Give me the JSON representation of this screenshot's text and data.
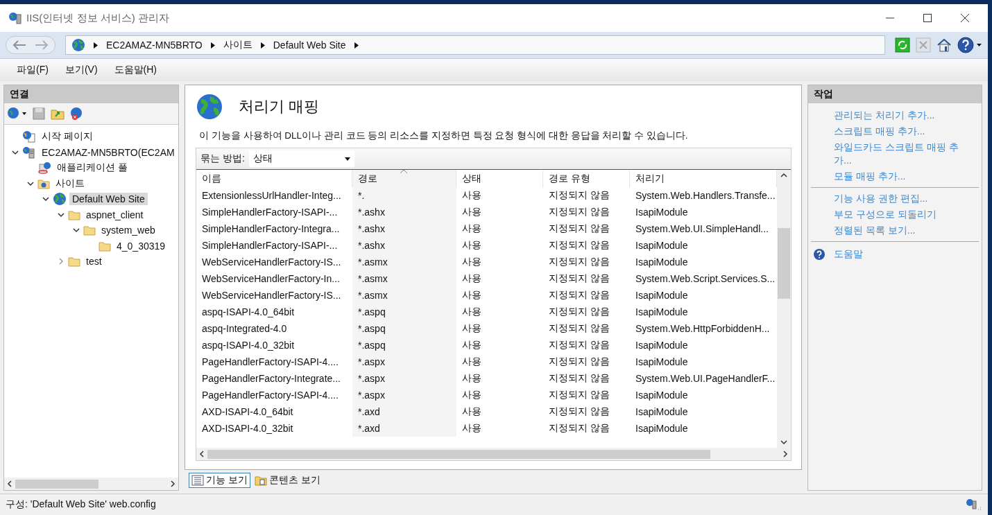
{
  "window": {
    "title": "IIS(인터넷 정보 서비스) 관리자"
  },
  "breadcrumb": [
    "EC2AMAZ-MN5BRTO",
    "사이트",
    "Default Web Site"
  ],
  "menu": [
    "파일(F)",
    "보기(V)",
    "도움말(H)"
  ],
  "connections": {
    "title": "연결",
    "tree": [
      {
        "label": "시작 페이지",
        "kind": "start",
        "selected": false
      },
      {
        "label": "EC2AMAZ-MN5BRTO(EC2AM",
        "kind": "server",
        "selected": false,
        "expanded": true,
        "children": [
          {
            "label": "애플리케이션 풀",
            "kind": "pool",
            "selected": false
          },
          {
            "label": "사이트",
            "kind": "sites",
            "selected": false,
            "expanded": true,
            "children": [
              {
                "label": "Default Web Site",
                "kind": "site",
                "selected": true,
                "expanded": true,
                "children": [
                  {
                    "label": "aspnet_client",
                    "kind": "folder",
                    "selected": false,
                    "expanded": true,
                    "children": [
                      {
                        "label": "system_web",
                        "kind": "folder",
                        "selected": false,
                        "expanded": true,
                        "children": [
                          {
                            "label": "4_0_30319",
                            "kind": "folder",
                            "selected": false
                          }
                        ]
                      }
                    ]
                  },
                  {
                    "label": "test",
                    "kind": "folder",
                    "selected": false,
                    "expanded": false
                  }
                ]
              }
            ]
          }
        ]
      }
    ]
  },
  "feature": {
    "title": "처리기 매핑",
    "description": "이 기능을 사용하여 DLL이나 관리 코드 등의 리소스를 지정하면 특정 요청 형식에 대한 응답을 처리할 수 있습니다.",
    "group_by": {
      "label": "묶는 방법:",
      "value": "상태"
    },
    "columns": [
      "이름",
      "경로",
      "상태",
      "경로 유형",
      "처리기"
    ],
    "rows": [
      [
        "ExtensionlessUrlHandler-Integ...",
        "*.",
        "사용",
        "지정되지 않음",
        "System.Web.Handlers.Transfe..."
      ],
      [
        "SimpleHandlerFactory-ISAPI-...",
        "*.ashx",
        "사용",
        "지정되지 않음",
        "IsapiModule"
      ],
      [
        "SimpleHandlerFactory-Integra...",
        "*.ashx",
        "사용",
        "지정되지 않음",
        "System.Web.UI.SimpleHandl..."
      ],
      [
        "SimpleHandlerFactory-ISAPI-...",
        "*.ashx",
        "사용",
        "지정되지 않음",
        "IsapiModule"
      ],
      [
        "WebServiceHandlerFactory-IS...",
        "*.asmx",
        "사용",
        "지정되지 않음",
        "IsapiModule"
      ],
      [
        "WebServiceHandlerFactory-In...",
        "*.asmx",
        "사용",
        "지정되지 않음",
        "System.Web.Script.Services.S..."
      ],
      [
        "WebServiceHandlerFactory-IS...",
        "*.asmx",
        "사용",
        "지정되지 않음",
        "IsapiModule"
      ],
      [
        "aspq-ISAPI-4.0_64bit",
        "*.aspq",
        "사용",
        "지정되지 않음",
        "IsapiModule"
      ],
      [
        "aspq-Integrated-4.0",
        "*.aspq",
        "사용",
        "지정되지 않음",
        "System.Web.HttpForbiddenH..."
      ],
      [
        "aspq-ISAPI-4.0_32bit",
        "*.aspq",
        "사용",
        "지정되지 않음",
        "IsapiModule"
      ],
      [
        "PageHandlerFactory-ISAPI-4....",
        "*.aspx",
        "사용",
        "지정되지 않음",
        "IsapiModule"
      ],
      [
        "PageHandlerFactory-Integrate...",
        "*.aspx",
        "사용",
        "지정되지 않음",
        "System.Web.UI.PageHandlerF..."
      ],
      [
        "PageHandlerFactory-ISAPI-4....",
        "*.aspx",
        "사용",
        "지정되지 않음",
        "IsapiModule"
      ],
      [
        "AXD-ISAPI-4.0_64bit",
        "*.axd",
        "사용",
        "지정되지 않음",
        "IsapiModule"
      ],
      [
        "AXD-ISAPI-4.0_32bit",
        "*.axd",
        "사용",
        "지정되지 않음",
        "IsapiModule"
      ]
    ],
    "views": [
      {
        "label": "기능 보기",
        "selected": true
      },
      {
        "label": "콘텐츠 보기",
        "selected": false
      }
    ]
  },
  "actions": {
    "title": "작업",
    "groups": [
      [
        {
          "kind": "link",
          "label": "관리되는 처리기 추가..."
        },
        {
          "kind": "link",
          "label": "스크립트 매핑 추가..."
        },
        {
          "kind": "link",
          "label": "와일드카드 스크립트 매핑 추가..."
        },
        {
          "kind": "link",
          "label": "모듈 매핑 추가..."
        }
      ],
      [
        {
          "kind": "link",
          "label": "기능 사용 권한 편집..."
        },
        {
          "kind": "link",
          "label": "부모 구성으로 되돌리기"
        },
        {
          "kind": "link",
          "label": "정렬된 목록 보기..."
        }
      ],
      [
        {
          "kind": "help",
          "label": "도움말"
        }
      ]
    ]
  },
  "status_bar": "구성: 'Default Web Site' web.config"
}
